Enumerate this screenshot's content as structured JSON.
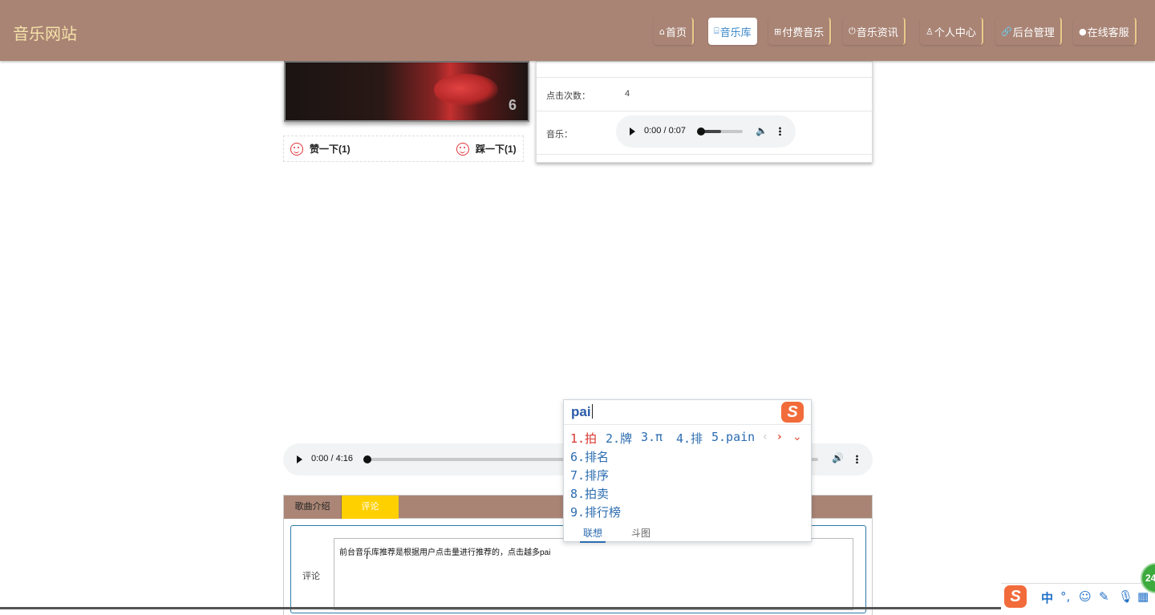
{
  "site": {
    "brand": "音乐网站"
  },
  "nav": [
    {
      "label": "首页",
      "icon": "home-icon",
      "glyph": "⌂"
    },
    {
      "label": "音乐库",
      "icon": "library-icon",
      "glyph": "⌸"
    },
    {
      "label": "付费音乐",
      "icon": "grid-icon",
      "glyph": "⊞"
    },
    {
      "label": "音乐资讯",
      "icon": "power-icon",
      "glyph": "⏻"
    },
    {
      "label": "个人中心",
      "icon": "user-icon",
      "glyph": "♙"
    },
    {
      "label": "后台管理",
      "icon": "link-icon",
      "glyph": "🔗"
    },
    {
      "label": "在线客服",
      "icon": "chat-icon",
      "glyph": "●"
    }
  ],
  "song": {
    "like_label": "赞一下(1)",
    "dislike_label": "踩一下(1)",
    "info": {
      "clicks_key": "点击次数：",
      "clicks_value": "4",
      "music_key": "音乐："
    },
    "mini_player": {
      "time": "0:00 / 0:07",
      "progress": 0,
      "volume": 0.5
    },
    "main_player": {
      "time": "0:00 / 4:16",
      "progress": 0
    }
  },
  "tabs": {
    "intro": "歌曲介绍",
    "comment": "评论"
  },
  "comment": {
    "label": "评论",
    "value": "前台音乐库推荐是根据用户点击量进行推荐的，点击越多pai"
  },
  "ime": {
    "composition": "pai",
    "candidates": [
      "1.拍",
      "2.牌",
      "3.π",
      "4.排",
      "5.pain"
    ],
    "more_candidates": [
      "6.排名",
      "7.排序",
      "8.拍卖",
      "9.排行榜"
    ],
    "footer_tabs": [
      "联想",
      "斗图"
    ],
    "logo": "S"
  },
  "tray": {
    "mode": "中",
    "punct": "°,",
    "badge": "24"
  }
}
